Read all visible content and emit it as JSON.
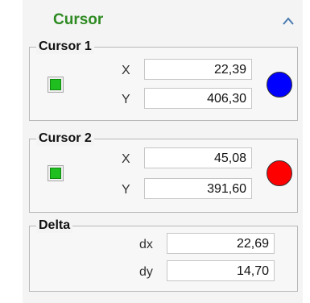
{
  "header": {
    "title": "Cursor"
  },
  "cursor1": {
    "title": "Cursor 1",
    "enabled": true,
    "x_label": "X",
    "x_value": "22,39",
    "y_label": "Y",
    "y_value": "406,30",
    "color": "#0000ff"
  },
  "cursor2": {
    "title": "Cursor 2",
    "enabled": true,
    "x_label": "X",
    "x_value": "45,08",
    "y_label": "Y",
    "y_value": "391,60",
    "color": "#ff0000"
  },
  "delta": {
    "title": "Delta",
    "dx_label": "dx",
    "dx_value": "22,69",
    "dy_label": "dy",
    "dy_value": "14,70"
  },
  "colors": {
    "header_text": "#2e8b22",
    "led_on": "#1fbf1f"
  },
  "icons": {
    "collapse": "chevron-up-icon"
  }
}
